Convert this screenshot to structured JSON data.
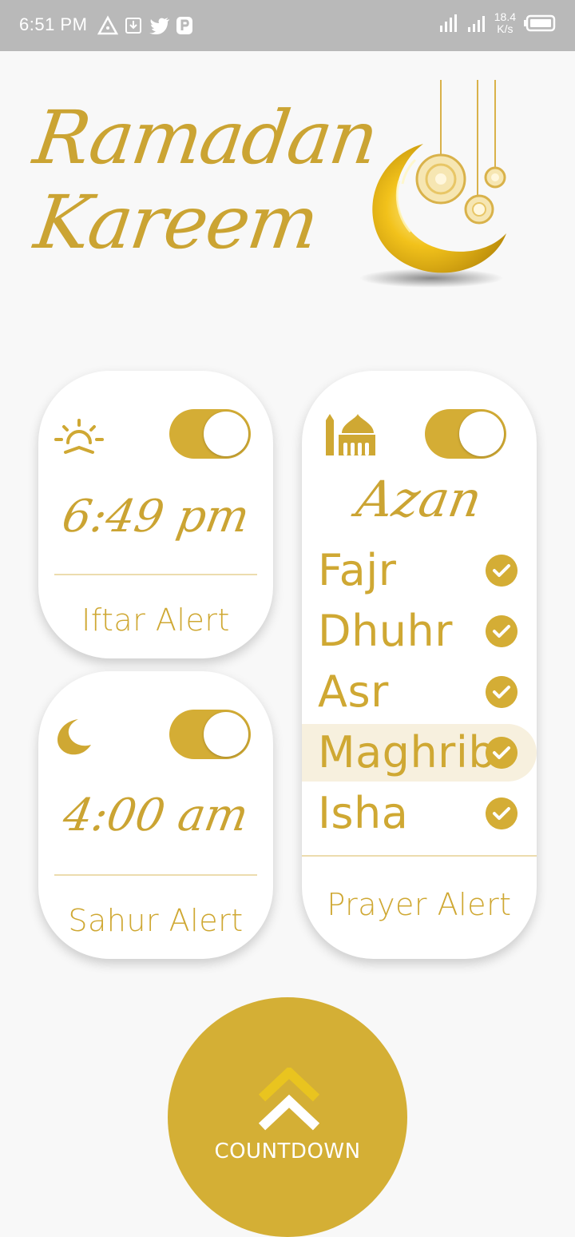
{
  "status_bar": {
    "time": "6:51 PM",
    "network_speed_value": "18.4",
    "network_speed_unit": "K/s",
    "notification_icons": [
      "delta-icon",
      "download-icon",
      "twitter-icon",
      "p-icon"
    ],
    "system_icons": [
      "signal-icon",
      "signal-icon",
      "battery-icon"
    ]
  },
  "header": {
    "title_line1": "Ramadan",
    "title_line2": "Kareem"
  },
  "iftar": {
    "icon": "sunset-icon",
    "enabled": true,
    "time": "6:49 pm",
    "label": "Iftar Alert"
  },
  "sahur": {
    "icon": "crescent-moon-icon",
    "enabled": true,
    "time": "4:00 am",
    "label": "Sahur Alert"
  },
  "prayer": {
    "icon": "mosque-icon",
    "enabled": true,
    "title": "Azan",
    "label": "Prayer Alert",
    "prayers": [
      {
        "name": "Fajr",
        "checked": true
      },
      {
        "name": "Dhuhr",
        "checked": true
      },
      {
        "name": "Asr",
        "checked": true
      },
      {
        "name": "Maghrib",
        "checked": true,
        "highlighted": true
      },
      {
        "name": "Isha",
        "checked": true
      }
    ]
  },
  "countdown": {
    "label": "COUNTDOWN",
    "icon": "double-chevron-up-icon"
  },
  "colors": {
    "gold": "#d4ad35",
    "highlight": "#f7f0de",
    "background": "#f8f8f8",
    "status_bar": "#b9b9b9"
  }
}
